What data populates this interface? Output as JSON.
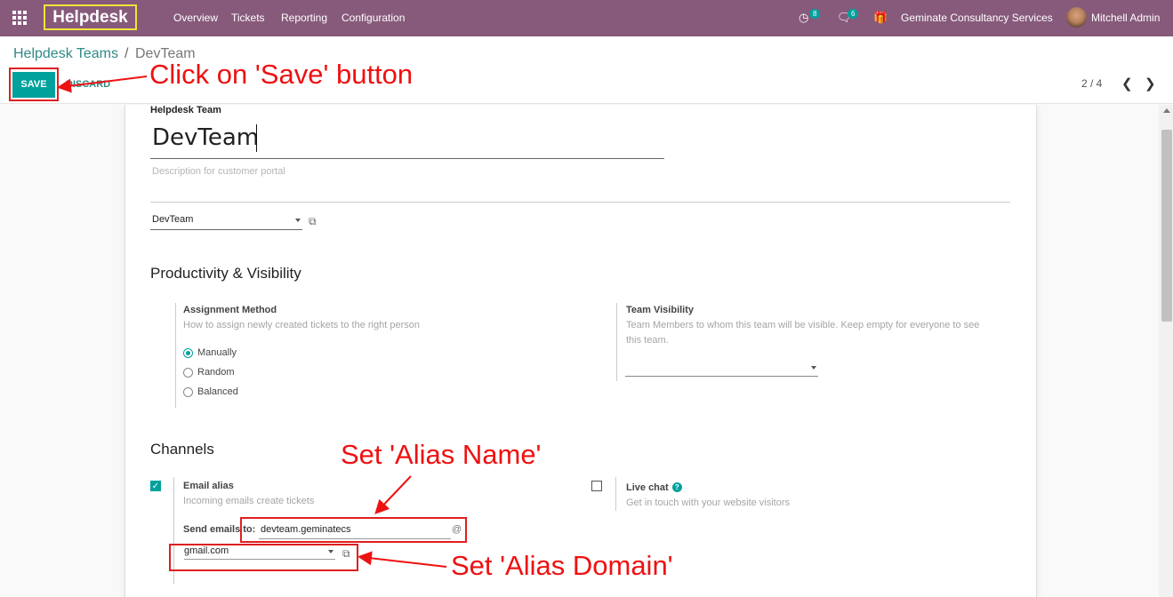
{
  "navbar": {
    "brand": "Helpdesk",
    "menu": [
      "Overview",
      "Tickets",
      "Reporting",
      "Configuration"
    ],
    "activity_count": "8",
    "messages_count": "6",
    "company": "Geminate Consultancy Services",
    "user": "Mitchell Admin",
    "colors": {
      "bar": "#875a7b",
      "accent": "#00a09d"
    }
  },
  "breadcrumb": {
    "parent": "Helpdesk Teams",
    "separator": "/",
    "current": "DevTeam"
  },
  "actions": {
    "save": "SAVE",
    "discard": "DISCARD"
  },
  "pager": {
    "text": "2 / 4"
  },
  "form": {
    "team_label": "Helpdesk Team",
    "team_name": "DevTeam",
    "description_placeholder": "Description for customer portal",
    "company_value": "DevTeam",
    "productivity": {
      "title": "Productivity & Visibility",
      "assignment_title": "Assignment Method",
      "assignment_help": "How to assign newly created tickets to the right person",
      "options": [
        "Manually",
        "Random",
        "Balanced"
      ],
      "selected": "Manually",
      "visibility_title": "Team Visibility",
      "visibility_help_1": "Team Members to whom this team will be visible. Keep empty for everyone to see",
      "visibility_help_2": "this team."
    },
    "channels": {
      "title": "Channels",
      "email_alias_title": "Email alias",
      "email_alias_help": "Incoming emails create tickets",
      "email_alias_checked": true,
      "send_to_label": "Send emails to:",
      "alias_name": "devteam.geminatecs",
      "at": "@",
      "alias_domain": "gmail.com",
      "live_chat_title": "Live chat",
      "live_chat_help": "Get in touch with your website visitors",
      "live_chat_checked": false
    }
  },
  "annotations": {
    "save": "Click on 'Save' button",
    "alias_name": "Set 'Alias Name'",
    "alias_domain": "Set 'Alias Domain'",
    "color": "#ee1111"
  }
}
